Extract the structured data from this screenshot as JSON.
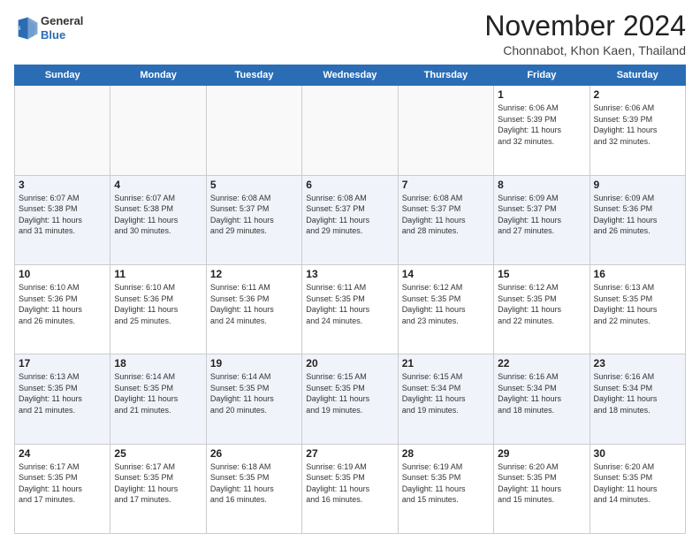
{
  "header": {
    "logo_line1": "General",
    "logo_line2": "Blue",
    "month": "November 2024",
    "location": "Chonnabot, Khon Kaen, Thailand"
  },
  "days_of_week": [
    "Sunday",
    "Monday",
    "Tuesday",
    "Wednesday",
    "Thursday",
    "Friday",
    "Saturday"
  ],
  "weeks": [
    [
      {
        "day": "",
        "info": ""
      },
      {
        "day": "",
        "info": ""
      },
      {
        "day": "",
        "info": ""
      },
      {
        "day": "",
        "info": ""
      },
      {
        "day": "",
        "info": ""
      },
      {
        "day": "1",
        "info": "Sunrise: 6:06 AM\nSunset: 5:39 PM\nDaylight: 11 hours\nand 32 minutes."
      },
      {
        "day": "2",
        "info": "Sunrise: 6:06 AM\nSunset: 5:39 PM\nDaylight: 11 hours\nand 32 minutes."
      }
    ],
    [
      {
        "day": "3",
        "info": "Sunrise: 6:07 AM\nSunset: 5:38 PM\nDaylight: 11 hours\nand 31 minutes."
      },
      {
        "day": "4",
        "info": "Sunrise: 6:07 AM\nSunset: 5:38 PM\nDaylight: 11 hours\nand 30 minutes."
      },
      {
        "day": "5",
        "info": "Sunrise: 6:08 AM\nSunset: 5:37 PM\nDaylight: 11 hours\nand 29 minutes."
      },
      {
        "day": "6",
        "info": "Sunrise: 6:08 AM\nSunset: 5:37 PM\nDaylight: 11 hours\nand 29 minutes."
      },
      {
        "day": "7",
        "info": "Sunrise: 6:08 AM\nSunset: 5:37 PM\nDaylight: 11 hours\nand 28 minutes."
      },
      {
        "day": "8",
        "info": "Sunrise: 6:09 AM\nSunset: 5:37 PM\nDaylight: 11 hours\nand 27 minutes."
      },
      {
        "day": "9",
        "info": "Sunrise: 6:09 AM\nSunset: 5:36 PM\nDaylight: 11 hours\nand 26 minutes."
      }
    ],
    [
      {
        "day": "10",
        "info": "Sunrise: 6:10 AM\nSunset: 5:36 PM\nDaylight: 11 hours\nand 26 minutes."
      },
      {
        "day": "11",
        "info": "Sunrise: 6:10 AM\nSunset: 5:36 PM\nDaylight: 11 hours\nand 25 minutes."
      },
      {
        "day": "12",
        "info": "Sunrise: 6:11 AM\nSunset: 5:36 PM\nDaylight: 11 hours\nand 24 minutes."
      },
      {
        "day": "13",
        "info": "Sunrise: 6:11 AM\nSunset: 5:35 PM\nDaylight: 11 hours\nand 24 minutes."
      },
      {
        "day": "14",
        "info": "Sunrise: 6:12 AM\nSunset: 5:35 PM\nDaylight: 11 hours\nand 23 minutes."
      },
      {
        "day": "15",
        "info": "Sunrise: 6:12 AM\nSunset: 5:35 PM\nDaylight: 11 hours\nand 22 minutes."
      },
      {
        "day": "16",
        "info": "Sunrise: 6:13 AM\nSunset: 5:35 PM\nDaylight: 11 hours\nand 22 minutes."
      }
    ],
    [
      {
        "day": "17",
        "info": "Sunrise: 6:13 AM\nSunset: 5:35 PM\nDaylight: 11 hours\nand 21 minutes."
      },
      {
        "day": "18",
        "info": "Sunrise: 6:14 AM\nSunset: 5:35 PM\nDaylight: 11 hours\nand 21 minutes."
      },
      {
        "day": "19",
        "info": "Sunrise: 6:14 AM\nSunset: 5:35 PM\nDaylight: 11 hours\nand 20 minutes."
      },
      {
        "day": "20",
        "info": "Sunrise: 6:15 AM\nSunset: 5:35 PM\nDaylight: 11 hours\nand 19 minutes."
      },
      {
        "day": "21",
        "info": "Sunrise: 6:15 AM\nSunset: 5:34 PM\nDaylight: 11 hours\nand 19 minutes."
      },
      {
        "day": "22",
        "info": "Sunrise: 6:16 AM\nSunset: 5:34 PM\nDaylight: 11 hours\nand 18 minutes."
      },
      {
        "day": "23",
        "info": "Sunrise: 6:16 AM\nSunset: 5:34 PM\nDaylight: 11 hours\nand 18 minutes."
      }
    ],
    [
      {
        "day": "24",
        "info": "Sunrise: 6:17 AM\nSunset: 5:35 PM\nDaylight: 11 hours\nand 17 minutes."
      },
      {
        "day": "25",
        "info": "Sunrise: 6:17 AM\nSunset: 5:35 PM\nDaylight: 11 hours\nand 17 minutes."
      },
      {
        "day": "26",
        "info": "Sunrise: 6:18 AM\nSunset: 5:35 PM\nDaylight: 11 hours\nand 16 minutes."
      },
      {
        "day": "27",
        "info": "Sunrise: 6:19 AM\nSunset: 5:35 PM\nDaylight: 11 hours\nand 16 minutes."
      },
      {
        "day": "28",
        "info": "Sunrise: 6:19 AM\nSunset: 5:35 PM\nDaylight: 11 hours\nand 15 minutes."
      },
      {
        "day": "29",
        "info": "Sunrise: 6:20 AM\nSunset: 5:35 PM\nDaylight: 11 hours\nand 15 minutes."
      },
      {
        "day": "30",
        "info": "Sunrise: 6:20 AM\nSunset: 5:35 PM\nDaylight: 11 hours\nand 14 minutes."
      }
    ]
  ]
}
